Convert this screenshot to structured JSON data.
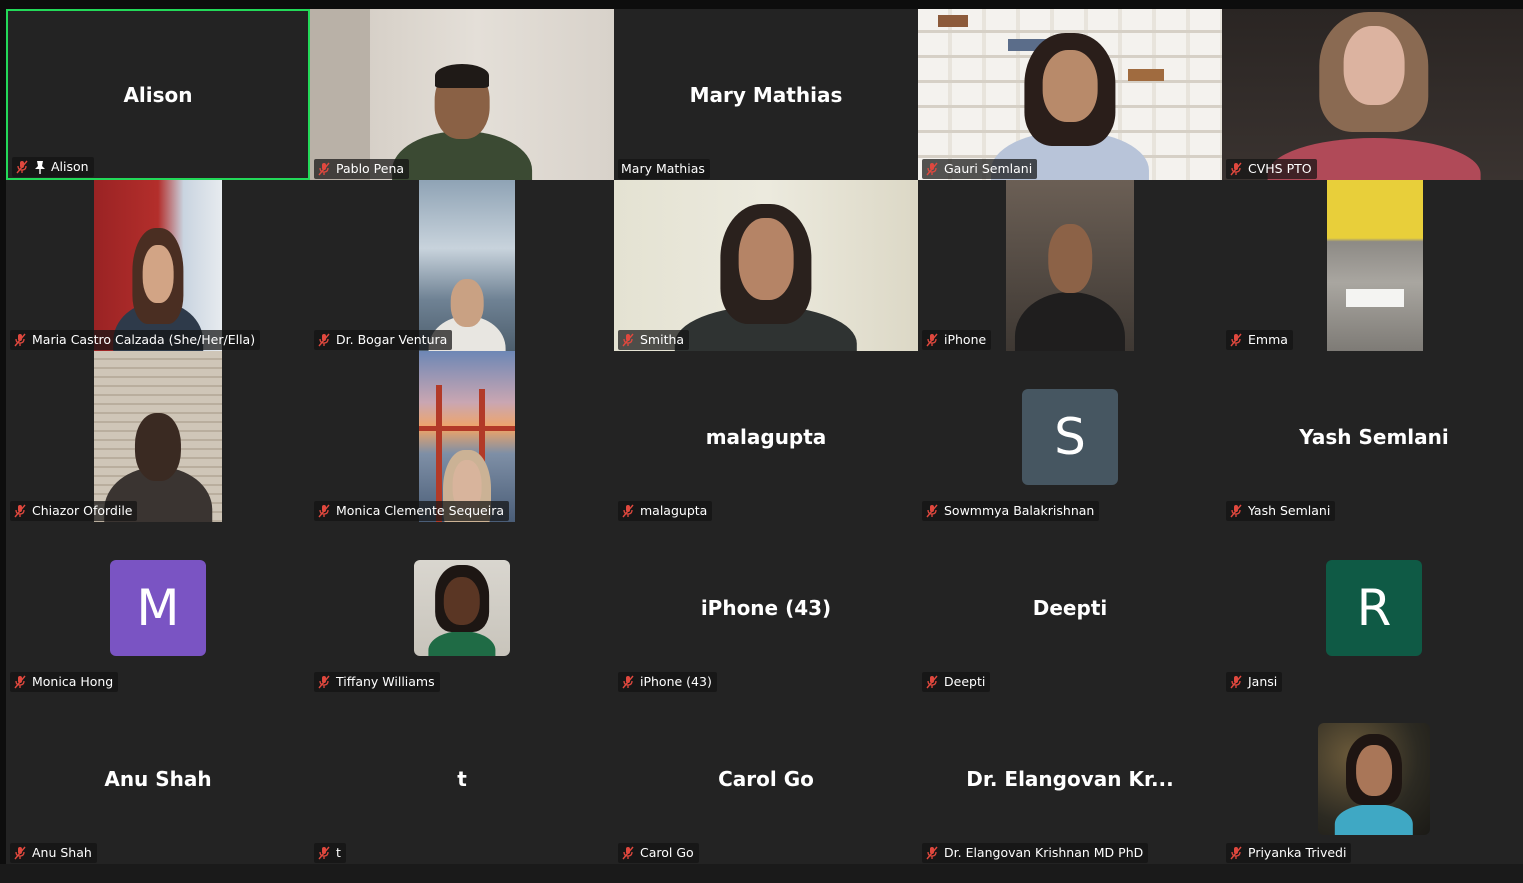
{
  "gallery": {
    "active_speaker_color": "#23d959",
    "tiles": [
      {
        "display_name": "Alison",
        "label": "Alison",
        "muted": true,
        "pinned": true
      },
      {
        "label": "Pablo Pena",
        "muted": true
      },
      {
        "display_name": "Mary Mathias",
        "label": "Mary Mathias",
        "muted": false
      },
      {
        "label": "Gauri Semlani",
        "muted": true
      },
      {
        "label": "CVHS PTO",
        "muted": true
      },
      {
        "label": "Maria Castro Calzada (She/Her/Ella)",
        "muted": true
      },
      {
        "label": "Dr. Bogar Ventura",
        "muted": true
      },
      {
        "label": "Smitha",
        "muted": true
      },
      {
        "label": "iPhone",
        "muted": true
      },
      {
        "label": "Emma",
        "muted": true
      },
      {
        "label": "Chiazor Ofordile",
        "muted": true
      },
      {
        "label": "Monica Clemente Sequeira",
        "muted": true
      },
      {
        "display_name": "malagupta",
        "label": "malagupta",
        "muted": true
      },
      {
        "avatar_letter": "S",
        "avatar_color": "#465661",
        "label": "Sowmmya Balakrishnan",
        "muted": true
      },
      {
        "display_name": "Yash Semlani",
        "label": "Yash Semlani",
        "muted": true
      },
      {
        "avatar_letter": "M",
        "avatar_color": "#7a54c3",
        "label": "Monica Hong",
        "muted": true
      },
      {
        "label": "Tiffany Williams",
        "muted": true
      },
      {
        "display_name": "iPhone (43)",
        "label": "iPhone (43)",
        "muted": true
      },
      {
        "display_name": "Deepti",
        "label": "Deepti",
        "muted": true
      },
      {
        "avatar_letter": "R",
        "avatar_color": "#0f5a45",
        "label": "Jansi",
        "muted": true
      },
      {
        "display_name": "Anu Shah",
        "label": "Anu Shah",
        "muted": true
      },
      {
        "display_name": "t",
        "label": "t",
        "muted": true
      },
      {
        "display_name": "Carol Go",
        "label": "Carol Go",
        "muted": true
      },
      {
        "display_name": "Dr. Elangovan Kr...",
        "label": "Dr. Elangovan Krishnan MD PhD",
        "muted": true
      },
      {
        "label": "Priyanka Trivedi",
        "muted": true
      }
    ]
  },
  "icons": {
    "muted_mic": "muted-mic-icon",
    "pin": "pin-icon"
  },
  "colors": {
    "muted_icon": "#e0483e",
    "tile_bg": "#232323",
    "window_bg": "#0d0d0d"
  }
}
